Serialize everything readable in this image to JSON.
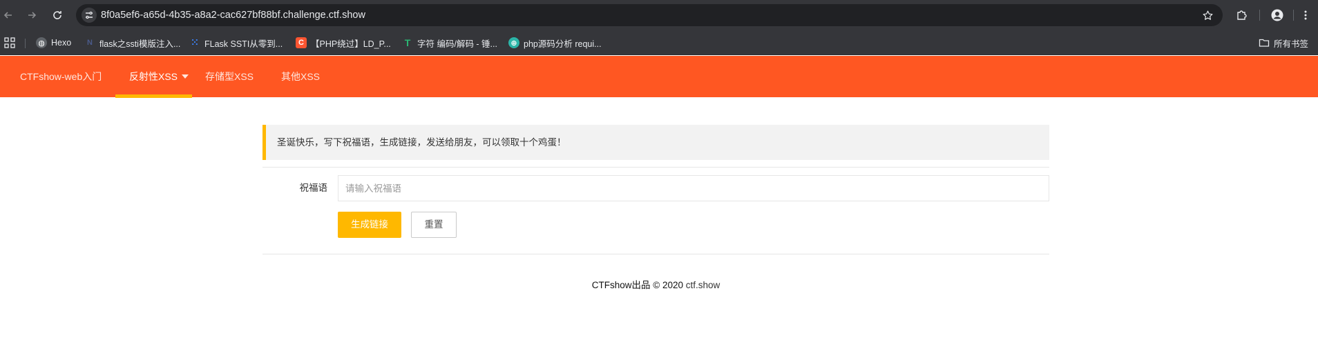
{
  "browser": {
    "url": "8f0a5ef6-a65d-4b35-a8a2-cac627bf88bf.challenge.ctf.show",
    "bookmarks": [
      {
        "label": "Hexo",
        "icon": "globe-icon"
      },
      {
        "label": "flask之ssti模版注入...",
        "icon": "n-logo-icon"
      },
      {
        "label": "FLask SSTI从零到...",
        "icon": "csdn-grid-icon"
      },
      {
        "label": "【PHP绕过】LD_P...",
        "icon": "c-logo-icon"
      },
      {
        "label": "字符 编码/解码 - 锤...",
        "icon": "t-logo-icon"
      },
      {
        "label": "php源码分析 requi...",
        "icon": "lock-logo-icon"
      }
    ],
    "all_bookmarks": "所有书签"
  },
  "nav": {
    "items": [
      {
        "label": "CTFshow-web入门"
      },
      {
        "label": "反射性XSS"
      },
      {
        "label": "存储型XSS"
      },
      {
        "label": "其他XSS"
      }
    ],
    "accent": "#ff5722",
    "highlight": "#ffb800"
  },
  "notice": {
    "text": "圣诞快乐，写下祝福语，生成链接，发送给朋友，可以领取十个鸡蛋！"
  },
  "form": {
    "label": "祝福语",
    "placeholder": "请输入祝福语",
    "value": "",
    "submit_label": "生成链接",
    "reset_label": "重置"
  },
  "footer": {
    "text": "CTFshow出品 © 2020 ",
    "link": "ctf.show"
  }
}
